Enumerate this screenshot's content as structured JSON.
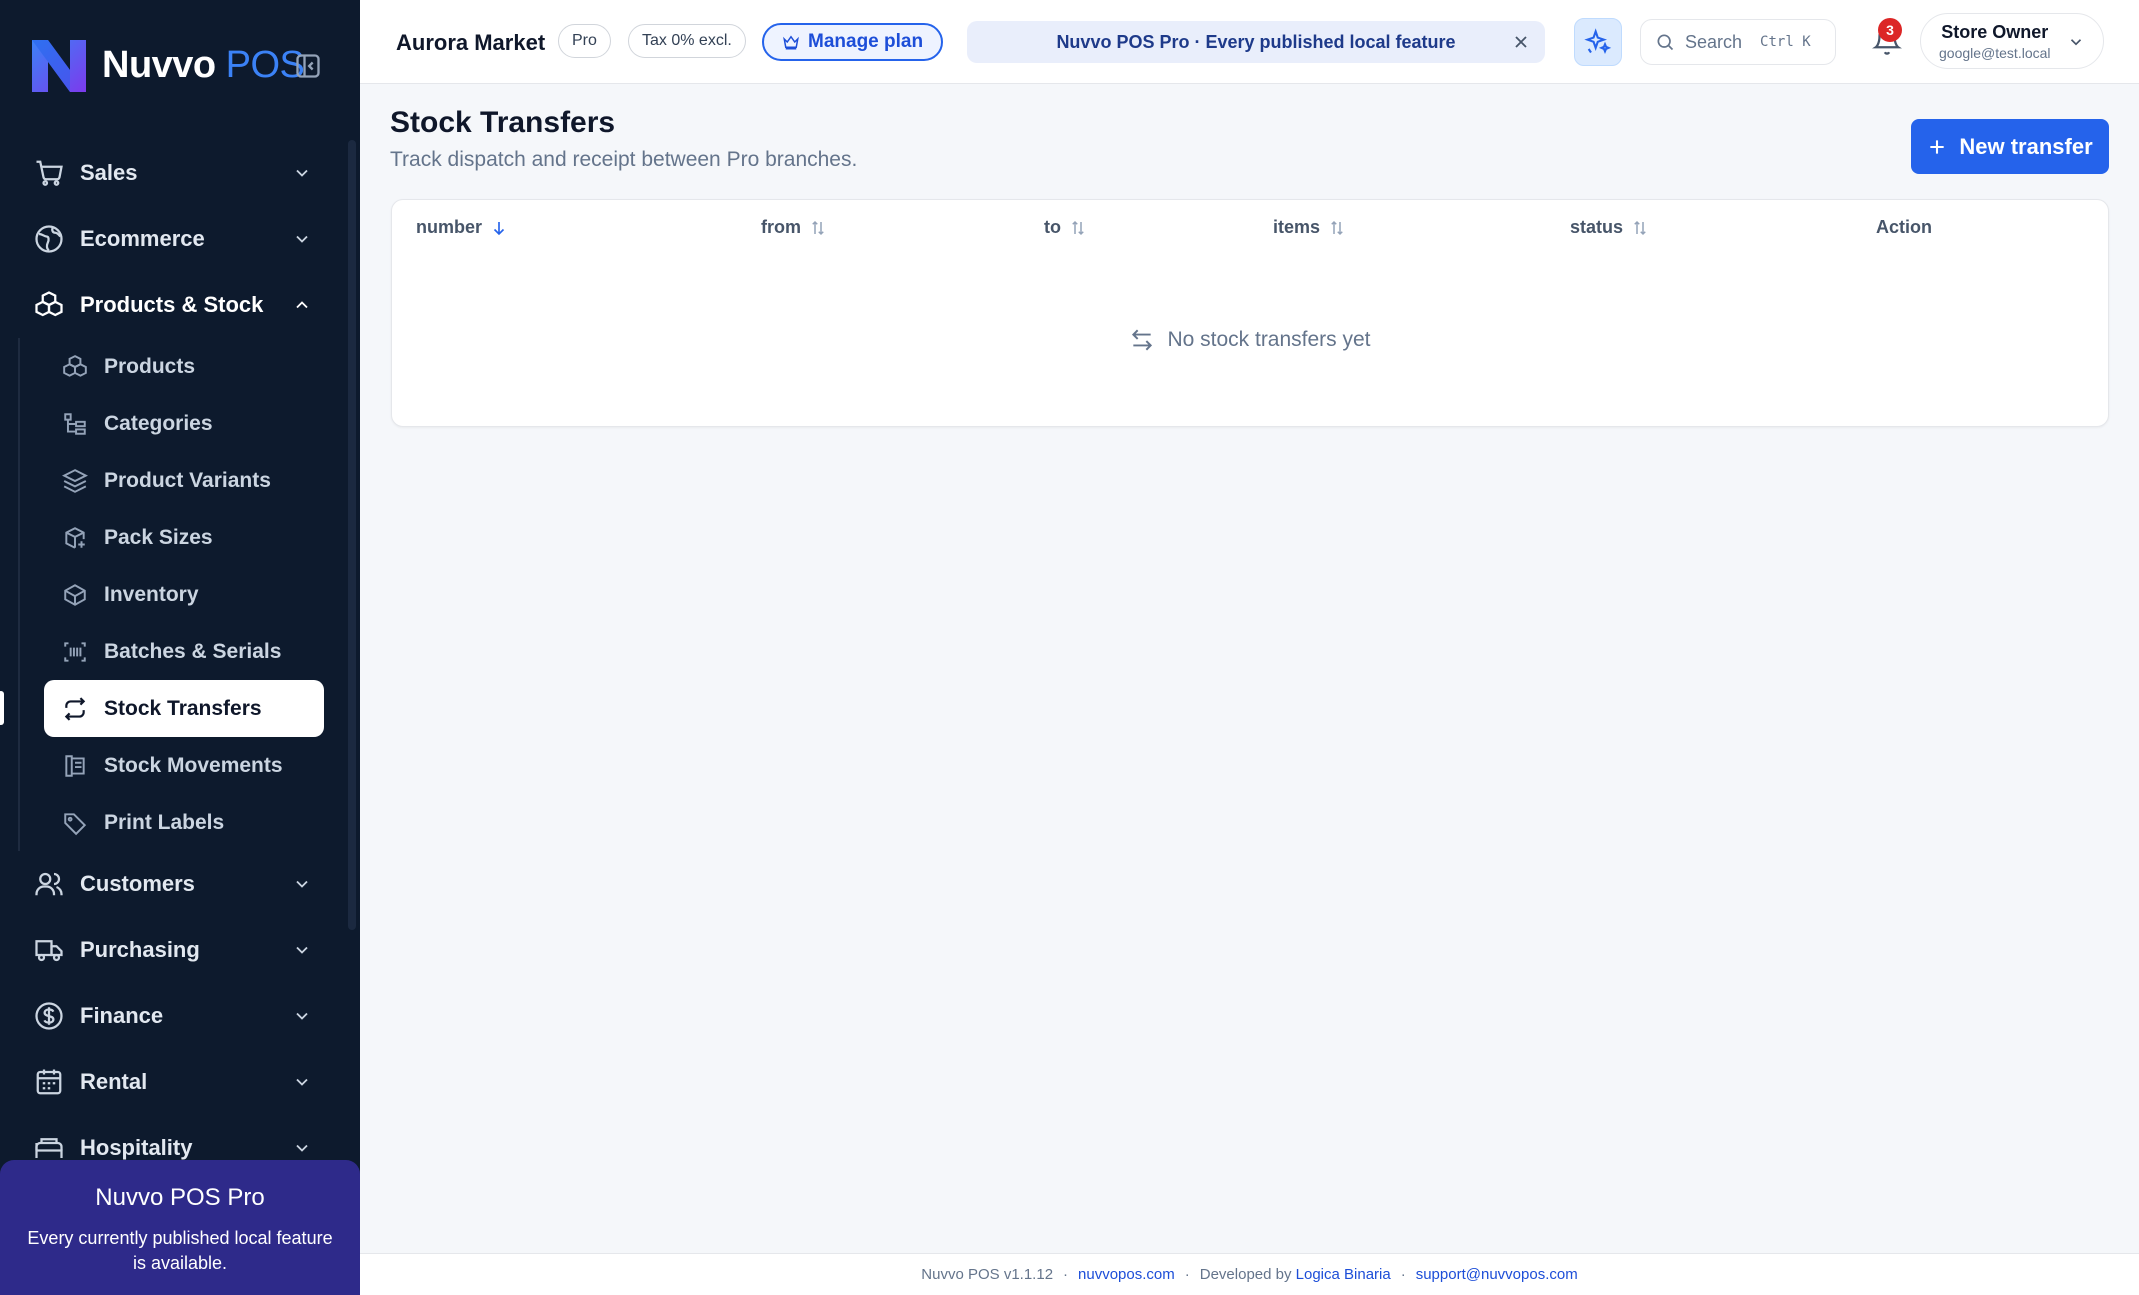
{
  "brand": {
    "name": "Nuvvo",
    "suffix": "POS"
  },
  "sidebar": {
    "groups_top": [
      {
        "label": "Sales",
        "icon": "cart-icon"
      },
      {
        "label": "Ecommerce",
        "icon": "globe-icon"
      },
      {
        "label": "Products & Stock",
        "icon": "boxes-icon"
      }
    ],
    "sub_items": [
      {
        "label": "Products",
        "icon": "boxes-icon"
      },
      {
        "label": "Categories",
        "icon": "tree-icon"
      },
      {
        "label": "Product Variants",
        "icon": "layers-icon"
      },
      {
        "label": "Pack Sizes",
        "icon": "package-plus-icon"
      },
      {
        "label": "Inventory",
        "icon": "box-icon"
      },
      {
        "label": "Batches & Serials",
        "icon": "barcode-icon"
      },
      {
        "label": "Stock Transfers",
        "icon": "repeat-icon",
        "active": true
      },
      {
        "label": "Stock Movements",
        "icon": "ledger-icon"
      },
      {
        "label": "Print Labels",
        "icon": "tag-icon"
      }
    ],
    "groups_bottom": [
      {
        "label": "Customers",
        "icon": "users-icon"
      },
      {
        "label": "Purchasing",
        "icon": "truck-icon"
      },
      {
        "label": "Finance",
        "icon": "dollar-icon"
      },
      {
        "label": "Rental",
        "icon": "calendar-icon"
      },
      {
        "label": "Hospitality",
        "icon": "bed-icon"
      }
    ],
    "promo": {
      "title": "Nuvvo POS Pro",
      "text": "Every currently published local feature is available."
    }
  },
  "header": {
    "store_name": "Aurora Market",
    "plan_pill": "Pro",
    "tax_pill": "Tax 0% excl.",
    "manage_plan": "Manage plan",
    "banner": "Nuvvo POS Pro · Every published local feature",
    "search_placeholder": "Search",
    "search_shortcut": "Ctrl K",
    "notifications_count": "3",
    "user_name": "Store Owner",
    "user_email": "google@test.local"
  },
  "main": {
    "title": "Stock Transfers",
    "subtitle": "Track dispatch and receipt between Pro branches.",
    "new_button": "New transfer",
    "columns": [
      "number",
      "from",
      "to",
      "items",
      "status",
      "Action"
    ],
    "empty_text": "No stock transfers yet"
  },
  "footer": {
    "version": "Nuvvo POS v1.1.12",
    "site": "nuvvopos.com",
    "developed_by": "Developed by",
    "developer": "Logica Binaria",
    "support": "support@nuvvopos.com",
    "separator": "·"
  },
  "colors": {
    "sidebar_bg": "#0d1a2d",
    "accent": "#2563eb",
    "promo_bg": "#2e2a8a",
    "badge": "#dc2626"
  }
}
